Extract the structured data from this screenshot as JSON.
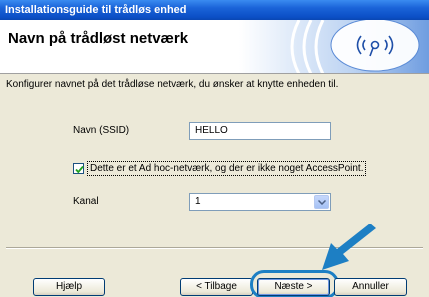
{
  "window": {
    "title": "Installationsguide til trådløs enhed"
  },
  "header": {
    "title": "Navn på trådløst netværk"
  },
  "instruction": "Konfigurer navnet på det trådløse netværk, du ønsker at knytte enheden til.",
  "form": {
    "ssid_label": "Navn (SSID)",
    "ssid_value": "HELLO",
    "adhoc_checkbox_label": "Dette er et Ad hoc-netværk, og der er ikke noget AccessPoint.",
    "adhoc_checked": true,
    "channel_label": "Kanal",
    "channel_value": "1"
  },
  "buttons": {
    "help": "Hjælp",
    "back": "< Tilbage",
    "next": "Næste >",
    "cancel": "Annuller"
  },
  "colors": {
    "titlebar": "#0b4fc6",
    "callout_arrow": "#1d7fc4"
  },
  "icons": {
    "banner": "wireless-waves-icon",
    "callout": "pointer-arrow-icon"
  }
}
